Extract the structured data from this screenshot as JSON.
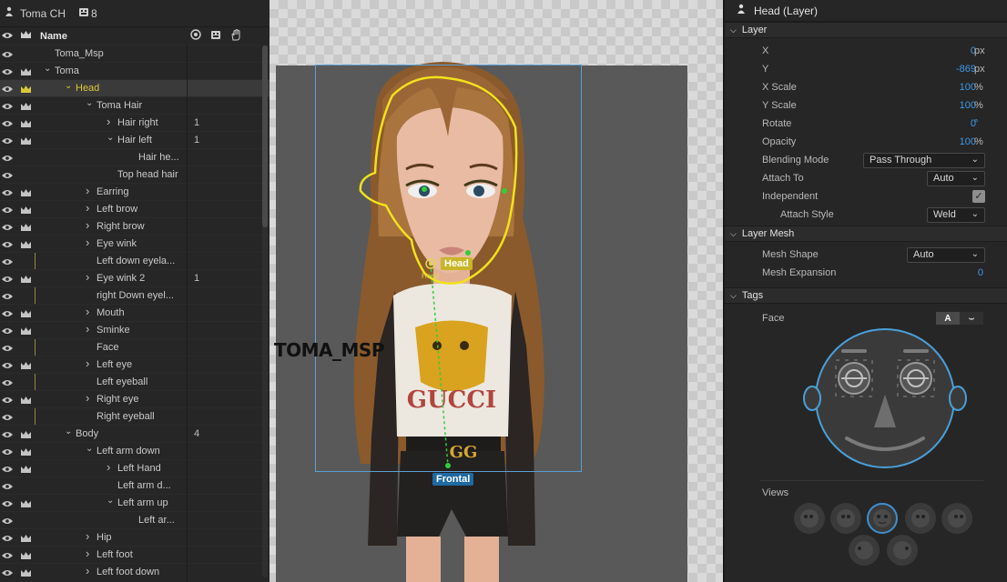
{
  "left_panel": {
    "title": "Toma CH",
    "layer_count": "8",
    "header": {
      "name": "Name"
    },
    "rows": [
      {
        "name": "Toma_Msp",
        "indent": 0,
        "eye": true,
        "crown": false,
        "chev": "",
        "num": "",
        "vline": false
      },
      {
        "name": "Toma",
        "indent": 0,
        "eye": true,
        "crown": true,
        "chev": "down",
        "num": "",
        "vline": false
      },
      {
        "name": "Head",
        "indent": 1,
        "eye": true,
        "crown": true,
        "chev": "down",
        "num": "",
        "vline": false,
        "selected": true
      },
      {
        "name": "Toma Hair",
        "indent": 2,
        "eye": true,
        "crown": true,
        "chev": "down",
        "num": "",
        "vline": false
      },
      {
        "name": "Hair right",
        "indent": 3,
        "eye": true,
        "crown": true,
        "chev": "right",
        "num": "1",
        "vline": false
      },
      {
        "name": "Hair left",
        "indent": 3,
        "eye": true,
        "crown": true,
        "chev": "down",
        "num": "1",
        "vline": false
      },
      {
        "name": "Hair he...",
        "indent": 4,
        "eye": true,
        "crown": false,
        "chev": "",
        "num": "",
        "vline": false
      },
      {
        "name": "Top head hair",
        "indent": 3,
        "eye": true,
        "crown": false,
        "chev": "",
        "num": "",
        "vline": false
      },
      {
        "name": "Earring",
        "indent": 2,
        "eye": true,
        "crown": true,
        "chev": "right",
        "num": "",
        "vline": false
      },
      {
        "name": "Left brow",
        "indent": 2,
        "eye": true,
        "crown": true,
        "chev": "right",
        "num": "",
        "vline": false
      },
      {
        "name": "Right brow",
        "indent": 2,
        "eye": true,
        "crown": true,
        "chev": "right",
        "num": "",
        "vline": false
      },
      {
        "name": "Eye wink",
        "indent": 2,
        "eye": true,
        "crown": true,
        "chev": "right",
        "num": "",
        "vline": false
      },
      {
        "name": "Left down eyela...",
        "indent": 2,
        "eye": true,
        "crown": false,
        "chev": "",
        "num": "",
        "vline": true
      },
      {
        "name": "Eye wink 2",
        "indent": 2,
        "eye": true,
        "crown": true,
        "chev": "right",
        "num": "1",
        "vline": false
      },
      {
        "name": "right Down eyel...",
        "indent": 2,
        "eye": true,
        "crown": false,
        "chev": "",
        "num": "",
        "vline": true
      },
      {
        "name": "Mouth",
        "indent": 2,
        "eye": true,
        "crown": true,
        "chev": "right",
        "num": "",
        "vline": false
      },
      {
        "name": "Sminke",
        "indent": 2,
        "eye": true,
        "crown": true,
        "chev": "right",
        "num": "",
        "vline": false
      },
      {
        "name": "Face",
        "indent": 2,
        "eye": true,
        "crown": false,
        "chev": "",
        "num": "",
        "vline": true
      },
      {
        "name": "Left eye",
        "indent": 2,
        "eye": true,
        "crown": true,
        "chev": "right",
        "num": "",
        "vline": false
      },
      {
        "name": "Left eyeball",
        "indent": 2,
        "eye": true,
        "crown": false,
        "chev": "",
        "num": "",
        "vline": true
      },
      {
        "name": "Right eye",
        "indent": 2,
        "eye": true,
        "crown": true,
        "chev": "right",
        "num": "",
        "vline": false
      },
      {
        "name": "Right eyeball",
        "indent": 2,
        "eye": true,
        "crown": false,
        "chev": "",
        "num": "",
        "vline": true
      },
      {
        "name": "Body",
        "indent": 1,
        "eye": true,
        "crown": true,
        "chev": "down",
        "num": "4",
        "vline": false
      },
      {
        "name": "Left arm down",
        "indent": 2,
        "eye": true,
        "crown": true,
        "chev": "down",
        "num": "",
        "vline": false
      },
      {
        "name": "Left Hand",
        "indent": 3,
        "eye": true,
        "crown": true,
        "chev": "right",
        "num": "",
        "vline": false
      },
      {
        "name": "Left arm d...",
        "indent": 3,
        "eye": true,
        "crown": false,
        "chev": "",
        "num": "",
        "vline": false
      },
      {
        "name": "Left arm up",
        "indent": 3,
        "eye": true,
        "crown": true,
        "chev": "down",
        "num": "",
        "vline": false
      },
      {
        "name": "Left ar...",
        "indent": 4,
        "eye": true,
        "crown": false,
        "chev": "",
        "num": "",
        "vline": false
      },
      {
        "name": "Hip",
        "indent": 2,
        "eye": true,
        "crown": true,
        "chev": "right",
        "num": "",
        "vline": false
      },
      {
        "name": "Left foot",
        "indent": 2,
        "eye": true,
        "crown": true,
        "chev": "right",
        "num": "",
        "vline": false
      },
      {
        "name": "Left foot down",
        "indent": 2,
        "eye": true,
        "crown": true,
        "chev": "right",
        "num": "",
        "vline": false
      }
    ]
  },
  "canvas": {
    "watermark": "TOMA_MSP",
    "head_tag": "Head",
    "head_handle_label": "Head",
    "frontal_tag": "Frontal"
  },
  "right_panel": {
    "title": "Head (Layer)",
    "layer_section": "Layer",
    "props": {
      "x_label": "X",
      "x_value": "0",
      "x_unit": "px",
      "y_label": "Y",
      "y_value": "-869",
      "y_unit": "px",
      "xscale_label": "X Scale",
      "xscale_value": "100",
      "xscale_unit": "%",
      "yscale_label": "Y Scale",
      "yscale_value": "100",
      "yscale_unit": "%",
      "rotate_label": "Rotate",
      "rotate_value": "0",
      "rotate_unit": "°",
      "opacity_label": "Opacity",
      "opacity_value": "100",
      "opacity_unit": "%",
      "blend_label": "Blending Mode",
      "blend_value": "Pass Through",
      "attach_label": "Attach To",
      "attach_value": "Auto",
      "independent_label": "Independent",
      "independent_checked": true,
      "attachstyle_label": "Attach Style",
      "attachstyle_value": "Weld"
    },
    "mesh_section": "Layer Mesh",
    "mesh": {
      "shape_label": "Mesh Shape",
      "shape_value": "Auto",
      "expansion_label": "Mesh Expansion",
      "expansion_value": "0"
    },
    "tags_section": "Tags",
    "tags": {
      "face_label": "Face",
      "toggle_a": "A",
      "toggle_b": "⌣",
      "views_label": "Views"
    }
  },
  "colors": {
    "accent_blue": "#3d9ae8",
    "selection_yellow": "#d8c93a",
    "head_outline": "#f2e21a",
    "face_blue": "#4a9fd8"
  }
}
